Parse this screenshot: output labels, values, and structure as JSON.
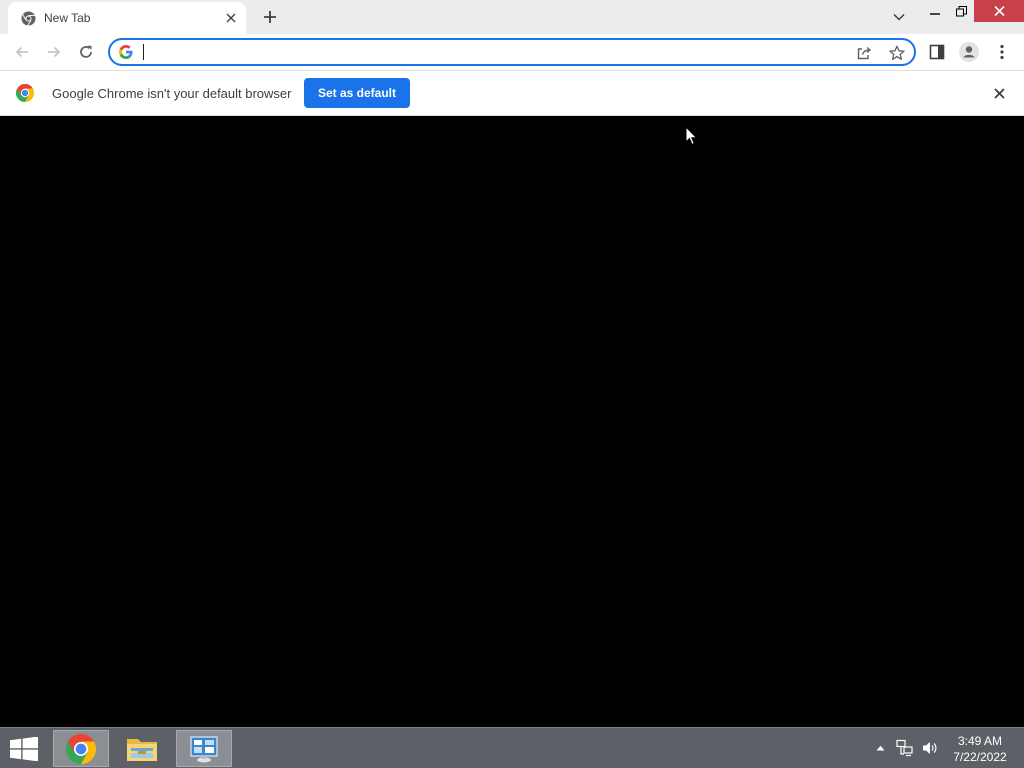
{
  "tab": {
    "title": "New Tab",
    "favicon": "chrome-icon"
  },
  "toolbar": {
    "back_icon": "arrow-left-icon",
    "forward_icon": "arrow-right-icon",
    "reload_icon": "reload-icon",
    "omnibox_value": "",
    "omnibox_search_engine_icon": "google-g-icon",
    "share_icon": "share-icon",
    "bookmark_icon": "star-icon",
    "side_panel_icon": "side-panel-icon",
    "profile_icon": "profile-icon",
    "menu_icon": "three-dot-menu-icon"
  },
  "infobar": {
    "message": "Google Chrome isn't your default browser",
    "button_label": "Set as default"
  },
  "colors": {
    "accent": "#1a73e8",
    "close_red": "#c7404a",
    "taskbar": "#5d6066",
    "tabstrip": "#ececec"
  },
  "taskbar": {
    "apps": [
      "chrome-icon",
      "file-explorer-icon",
      "control-panel-icon"
    ],
    "time": "3:49 AM",
    "date": "7/22/2022"
  }
}
